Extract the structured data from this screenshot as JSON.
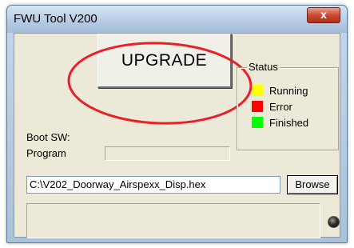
{
  "window": {
    "title": "FWU Tool V200",
    "close_glyph": "x"
  },
  "upgrade_button": {
    "label": "UPGRADE"
  },
  "status": {
    "legend": "Status",
    "items": [
      {
        "label": "Running",
        "color": "#ffff00"
      },
      {
        "label": "Error",
        "color": "#ff0000"
      },
      {
        "label": "Finished",
        "color": "#00ff00"
      }
    ]
  },
  "boot_sw": {
    "label_line1": "Boot SW:",
    "label_line2": "Program",
    "value": ""
  },
  "file": {
    "path": "C:\\V202_Doorway_Airspexx_Disp.hex",
    "browse_label": "Browse"
  },
  "progress": {
    "value": 0
  },
  "indicator": {
    "icon": "led-indicator-icon",
    "state": "off"
  },
  "annotation": {
    "color": "#e8202a"
  }
}
